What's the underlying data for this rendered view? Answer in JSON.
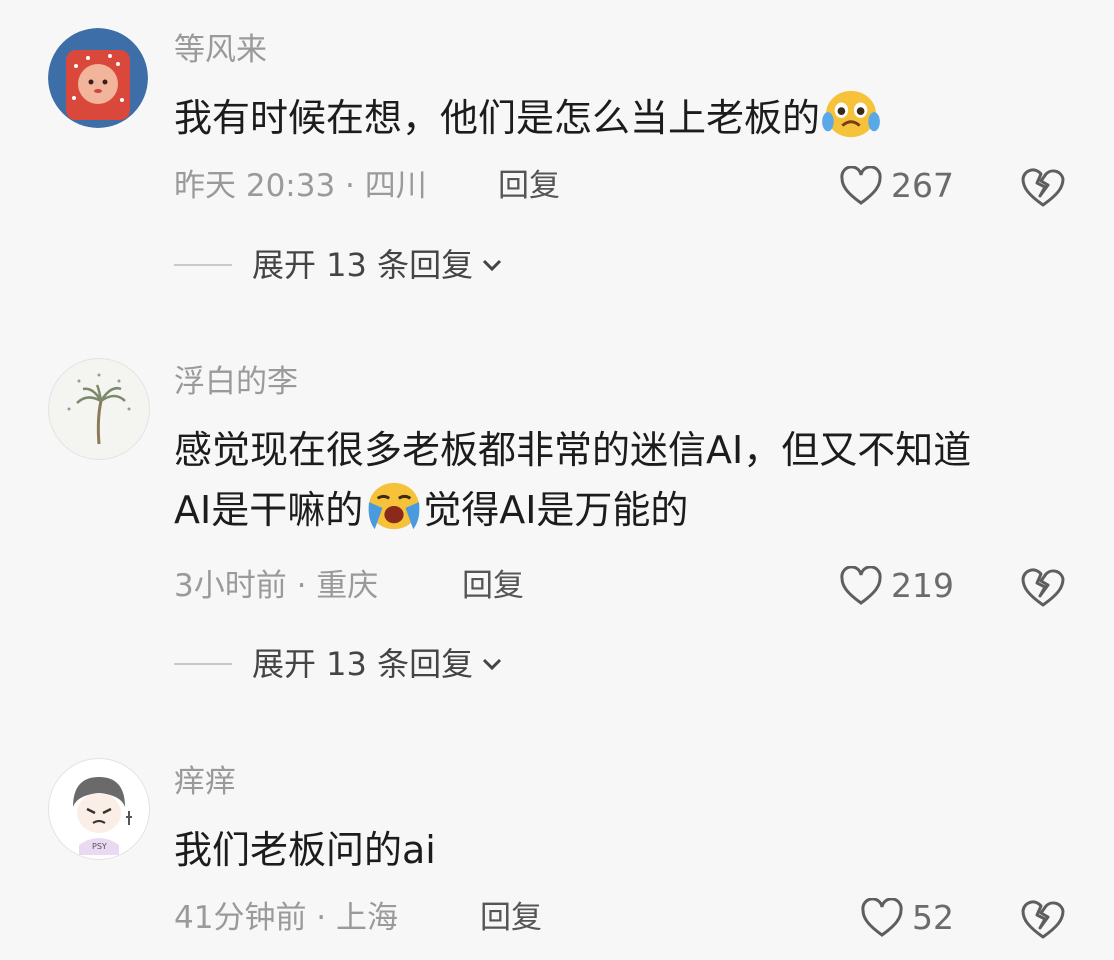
{
  "comments": [
    {
      "username": "等风来",
      "text": "我有时候在想，他们是怎么当上老板的",
      "emoji": "crying-face",
      "time_location": "昨天 20:33 · 四川",
      "reply": "回复",
      "likes": "267",
      "expand": "展开 13 条回复"
    },
    {
      "username": "浮白的李",
      "text_line1": "感觉现在很多老板都非常的迷信AI，但又不知道",
      "text_line2_a": "AI是干嘛的",
      "text_line2_b": "觉得AI是万能的",
      "emoji": "loudly-crying-face",
      "time_location": "3小时前 · 重庆",
      "reply": "回复",
      "likes": "219",
      "expand": "展开 13 条回复"
    },
    {
      "username": "痒痒",
      "text": "我们老板问的ai",
      "time_location": "41分钟前 · 上海",
      "reply": "回复",
      "likes": "52"
    }
  ],
  "colors": {
    "background": "#f7f7f7",
    "meta_text": "#9a9a9a",
    "body_text": "#1c1c1c",
    "avatar1_border": "#3d6ea8",
    "avatar1_fill": "#d9483a"
  }
}
